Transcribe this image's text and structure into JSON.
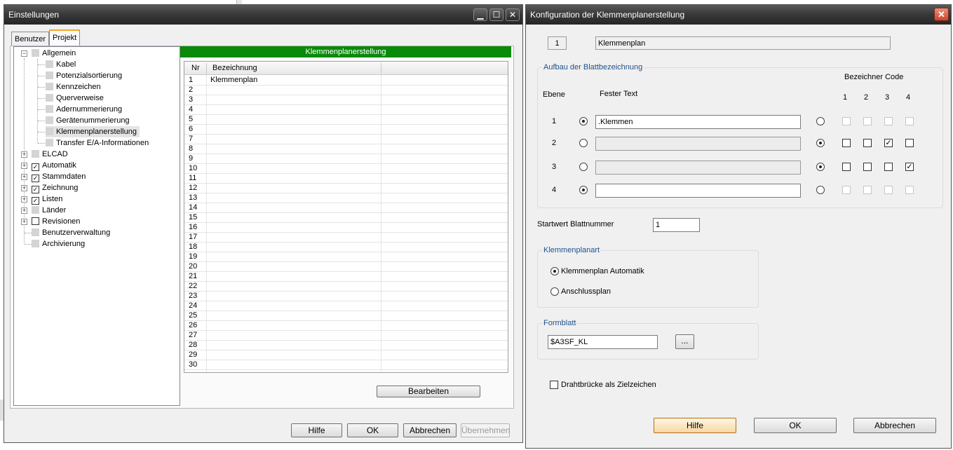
{
  "left_window": {
    "title": "Einstellungen",
    "tabs": [
      "Benutzer",
      "Projekt"
    ],
    "tree": {
      "root": "Allgemein",
      "children": [
        "Kabel",
        "Potenzialsortierung",
        "Kennzeichen",
        "Querverweise",
        "Adernummerierung",
        "Gerätenummerierung",
        "Klemmenplanerstellung",
        "Transfer E/A-Informationen"
      ],
      "top_items": [
        {
          "label": "ELCAD",
          "box": "square",
          "expandable": true
        },
        {
          "label": "Automatik",
          "box": "checked",
          "expandable": true
        },
        {
          "label": "Stammdaten",
          "box": "checked",
          "expandable": true
        },
        {
          "label": "Zeichnung",
          "box": "checked",
          "expandable": true
        },
        {
          "label": "Listen",
          "box": "checked",
          "expandable": true
        },
        {
          "label": "Länder",
          "box": "square",
          "expandable": true
        },
        {
          "label": "Revisionen",
          "box": "empty",
          "expandable": true
        },
        {
          "label": "Benutzerverwaltung",
          "box": "square",
          "expandable": false
        },
        {
          "label": "Archivierung",
          "box": "square",
          "expandable": false
        }
      ]
    },
    "section_header": "Klemmenplanerstellung",
    "columns": [
      "Nr",
      "Bezeichnung"
    ],
    "rows": [
      {
        "nr": "1",
        "bez": "Klemmenplan"
      },
      {
        "nr": "2",
        "bez": ""
      },
      {
        "nr": "3",
        "bez": ""
      },
      {
        "nr": "4",
        "bez": ""
      },
      {
        "nr": "5",
        "bez": ""
      },
      {
        "nr": "6",
        "bez": ""
      },
      {
        "nr": "7",
        "bez": ""
      },
      {
        "nr": "8",
        "bez": ""
      },
      {
        "nr": "9",
        "bez": ""
      },
      {
        "nr": "10",
        "bez": ""
      },
      {
        "nr": "11",
        "bez": ""
      },
      {
        "nr": "12",
        "bez": ""
      },
      {
        "nr": "13",
        "bez": ""
      },
      {
        "nr": "14",
        "bez": ""
      },
      {
        "nr": "15",
        "bez": ""
      },
      {
        "nr": "16",
        "bez": ""
      },
      {
        "nr": "17",
        "bez": ""
      },
      {
        "nr": "18",
        "bez": ""
      },
      {
        "nr": "19",
        "bez": ""
      },
      {
        "nr": "20",
        "bez": ""
      },
      {
        "nr": "21",
        "bez": ""
      },
      {
        "nr": "22",
        "bez": ""
      },
      {
        "nr": "23",
        "bez": ""
      },
      {
        "nr": "24",
        "bez": ""
      },
      {
        "nr": "25",
        "bez": ""
      },
      {
        "nr": "26",
        "bez": ""
      },
      {
        "nr": "27",
        "bez": ""
      },
      {
        "nr": "28",
        "bez": ""
      },
      {
        "nr": "29",
        "bez": ""
      },
      {
        "nr": "30",
        "bez": ""
      }
    ],
    "edit_button": "Bearbeiten",
    "footer_buttons": {
      "help": "Hilfe",
      "ok": "OK",
      "cancel": "Abbrechen",
      "apply": "Übernehmen"
    }
  },
  "right_window": {
    "title": "Konfiguration der Klemmenplanerstellung",
    "number": "1",
    "name": "Klemmenplan",
    "blatt_group": "Aufbau der Blattbezeichnung",
    "ebene_label": "Ebene",
    "fester_text_label": "Fester Text",
    "bezeichner_code_label": "Bezeichner Code",
    "code_columns": [
      "1",
      "2",
      "3",
      "4"
    ],
    "levels": [
      {
        "level": "1",
        "text_selected": true,
        "text": ".Klemmen",
        "text_enabled": true,
        "codes": [
          false,
          false,
          false,
          false
        ],
        "codes_enabled": false
      },
      {
        "level": "2",
        "text_selected": false,
        "text": "",
        "text_enabled": false,
        "codes": [
          false,
          false,
          true,
          false
        ],
        "codes_enabled": true
      },
      {
        "level": "3",
        "text_selected": false,
        "text": "",
        "text_enabled": false,
        "codes": [
          false,
          false,
          false,
          true
        ],
        "codes_enabled": true
      },
      {
        "level": "4",
        "text_selected": true,
        "text": "",
        "text_enabled": true,
        "codes": [
          false,
          false,
          false,
          false
        ],
        "codes_enabled": false
      }
    ],
    "startwert_label": "Startwert Blattnummer",
    "startwert_value": "1",
    "art_group": "Klemmenplanart",
    "art_options": [
      "Klemmenplan Automatik",
      "Anschlussplan"
    ],
    "art_selected": "Klemmenplan Automatik",
    "formblatt_group": "Formblatt",
    "formblatt_value": "$A3SF_KL",
    "browse_label": "...",
    "drahtbruecke_label": "Drahtbrücke als Zielzeichen",
    "drahtbruecke_checked": false,
    "buttons": {
      "help": "Hilfe",
      "ok": "OK",
      "cancel": "Abbrechen"
    }
  },
  "colors": {
    "section_header_bg": "#0a8a0a",
    "group_label": "#1f4f8f",
    "close_button": "#c9452a"
  }
}
